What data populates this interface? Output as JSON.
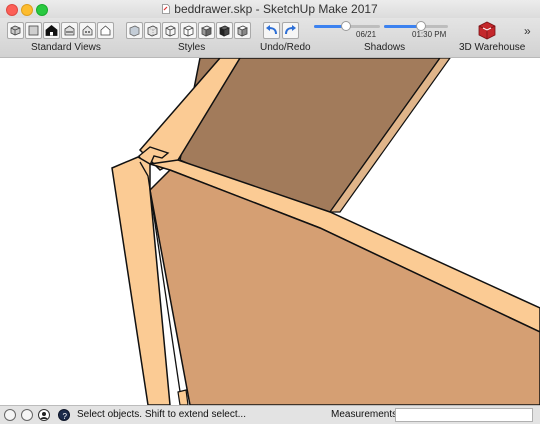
{
  "window": {
    "title": "beddrawer.skp - SketchUp Make 2017"
  },
  "toolbar": {
    "groups": {
      "standard_views": "Standard Views",
      "styles": "Styles",
      "undo_redo": "Undo/Redo",
      "shadows": "Shadows",
      "warehouse": "3D Warehouse"
    },
    "standard_view_icons": [
      "iso-view-icon",
      "top-view-icon",
      "front-view-icon",
      "right-view-icon",
      "back-view-icon",
      "left-view-icon"
    ],
    "style_icons": [
      "xray-style-icon",
      "back-edges-style-icon",
      "wireframe-style-icon",
      "hidden-line-style-icon",
      "shaded-style-icon",
      "shaded-textures-style-icon",
      "monochrome-style-icon"
    ],
    "shadow_date": {
      "label": "06/21",
      "fraction": 0.48
    },
    "shadow_time": {
      "label": "01:30 PM",
      "fraction": 0.58
    },
    "overflow": "»"
  },
  "status": {
    "message": "Select objects. Shift to extend select...",
    "measurements_label": "Measurements",
    "measurements_value": ""
  },
  "colors": {
    "wood_light": "#fbcb94",
    "wood_side": "#d59f73",
    "wood_inside": "#a27b5b",
    "edge": "#111111",
    "slider_accent": "#3c82f0"
  }
}
